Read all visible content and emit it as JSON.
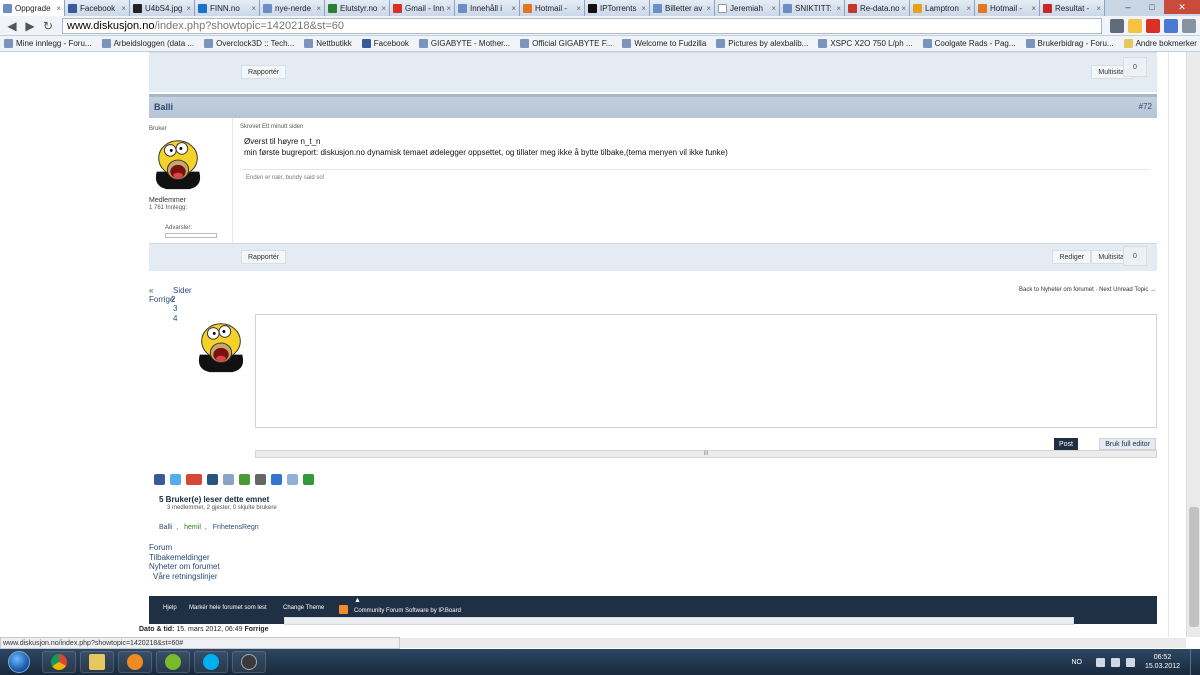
{
  "browser": {
    "tabs": [
      {
        "label": "Oppgrade",
        "active": true
      },
      {
        "label": "Facebook"
      },
      {
        "label": "U4bS4.jpg"
      },
      {
        "label": "FINN.no"
      },
      {
        "label": "nye-nerde"
      },
      {
        "label": "Elutstyr.no"
      },
      {
        "label": "Gmail - Inn"
      },
      {
        "label": "Innehåll i"
      },
      {
        "label": "Hotmail -"
      },
      {
        "label": "IPTorrents"
      },
      {
        "label": "Billetter av"
      },
      {
        "label": "Jeremiah"
      },
      {
        "label": "SNIKTITT:"
      },
      {
        "label": "Re-data.no"
      },
      {
        "label": "Lamptron"
      },
      {
        "label": "Hotmail -"
      },
      {
        "label": "Resultat -"
      }
    ],
    "url_host": "www.diskusjon.no",
    "url_path": "/index.php?showtopic=1420218&st=60",
    "bookmarks": [
      "Mine innlegg - Foru...",
      "Arbeidsloggen (data ...",
      "Overclock3D :: Tech...",
      "Nettbutikk",
      "Facebook",
      "GIGABYTE - Mother...",
      "Official GIGABYTE F...",
      "Welcome to Fudzilla",
      "Pictures by alexbalib...",
      "XSPC X2O 750 L/ph ...",
      "Coolgate Rads - Pag...",
      "Brukerbidrag - Foru..."
    ],
    "other_bookmarks": "Andre bokmerker",
    "status_url": "www.diskusjon.no/index.php?showtopic=1420218&st=60#"
  },
  "prev_post": {
    "report_label": "Rapportér",
    "multiquote_label": "Multisitat",
    "score": "0"
  },
  "post": {
    "author": "Balli",
    "number": "#72",
    "role": "Bruker",
    "group": "Medlemmer",
    "post_count": "1 761 Innlegg:",
    "warnings_label": "Advarsler:",
    "posted_time": "Skrevet Ett minutt siden",
    "line1": "Øverst til høyre n_t_n",
    "line2": "min første bugreport: diskusjon.no dynamisk temaet ødelegger oppsettet, og tillater meg ikke å bytte tilbake,(tema menyen vil ikke funke)",
    "signature": "Enden er nær, bundy said so!",
    "report_label": "Rapportér",
    "edit_label": "Rediger",
    "multiquote_label": "Multisitat",
    "score": "0"
  },
  "pagination": {
    "prev_arrow": "«",
    "prev_label": "Forrige",
    "pages_label": "Sider",
    "pages": [
      "2",
      "3",
      "4"
    ]
  },
  "back_link": "Back to Nyheter om forumet · Next Unread Topic →",
  "editor": {
    "post_label": "Post",
    "full_editor_label": "Bruk full editor",
    "scroll_grip": "III"
  },
  "share_icons": [
    {
      "name": "facebook-icon",
      "color": "#3b5998"
    },
    {
      "name": "twitter-icon",
      "color": "#55acee"
    },
    {
      "name": "google-plus-icon",
      "color": "#d34836"
    },
    {
      "name": "digg-icon",
      "color": "#27557f"
    },
    {
      "name": "email-icon",
      "color": "#8aa4c8"
    },
    {
      "name": "download-icon",
      "color": "#4a9a3a"
    },
    {
      "name": "print-icon",
      "color": "#666666"
    },
    {
      "name": "delicious-icon",
      "color": "#3274d0"
    },
    {
      "name": "reddit-icon",
      "color": "#8fb0d8"
    },
    {
      "name": "stumbleupon-icon",
      "color": "#2f9b3a"
    }
  ],
  "readers": {
    "title": "5 Bruker(e) leser dette emnet",
    "subtitle": "3 medlemmer, 2 gjester, 0 skjulte brukere",
    "users": [
      "Balli",
      "hemil",
      "FrihetensRegn"
    ]
  },
  "footer_links": [
    "Forum",
    "Tilbakemeldinger",
    "Nyheter om forumet",
    "Våre retningslinjer"
  ],
  "footer": {
    "help": "Hjelp",
    "mark_read": "Markér hele forumet som lest",
    "change_theme": "Change Theme",
    "ipboard": "Community Forum Software by IP.Board"
  },
  "date_label": "Dato & tid:",
  "date_value": "15. mars 2012, 06:49",
  "date_prev": "Forrige",
  "taskbar": {
    "lang": "NO",
    "time": "06:52",
    "date": "15.03.2012"
  },
  "colors": {
    "header_bar": "#b6c4d5",
    "footer": "#1f2f44",
    "link": "#2b4a75"
  }
}
